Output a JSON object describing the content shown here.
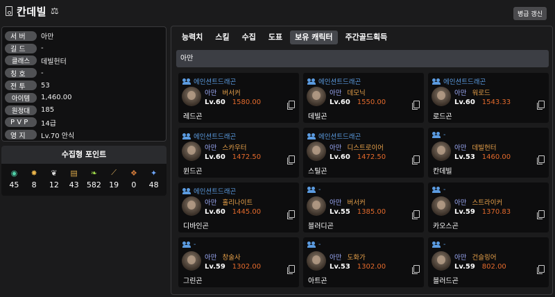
{
  "header": {
    "character_name": "칸데빌",
    "update_button": "병급 갱신"
  },
  "profile": [
    {
      "label": "서 버",
      "value": "아만"
    },
    {
      "label": "길 드",
      "value": "-"
    },
    {
      "label": "클래스",
      "value": "데빌헌터"
    },
    {
      "label": "칭 호",
      "value": "-"
    },
    {
      "label": "전 투",
      "value": "53"
    },
    {
      "label": "아이템",
      "value": "1,460.00"
    },
    {
      "label": "원정대",
      "value": "185"
    },
    {
      "label": "P V P",
      "value": "14급"
    },
    {
      "label": "영 지",
      "value": "Lv.70 안식"
    }
  ],
  "collect": {
    "title": "수집형 포인트",
    "items": [
      {
        "icon": "island-heart-icon",
        "value": "45"
      },
      {
        "icon": "giant-heart-icon",
        "value": "8"
      },
      {
        "icon": "mokoko-seed-icon",
        "value": "12"
      },
      {
        "icon": "masterpiece-icon",
        "value": "43"
      },
      {
        "icon": "sprout-icon",
        "value": "582"
      },
      {
        "icon": "adventure-icon",
        "value": "19"
      },
      {
        "icon": "orpheus-star-icon",
        "value": "0"
      },
      {
        "icon": "world-tree-leaf-icon",
        "value": "48"
      }
    ]
  },
  "tabs": [
    "능력치",
    "스킬",
    "수집",
    "도표",
    "보유 캐릭터",
    "주간골드획득"
  ],
  "active_tab": "보유 캐릭터",
  "server_section": "아만",
  "characters": [
    {
      "guild": "에인션트드래곤",
      "server": "아만",
      "class": "버서커",
      "level": "Lv.60",
      "item_level": "1580.00",
      "name": "레드곤"
    },
    {
      "guild": "에인션트드래곤",
      "server": "아만",
      "class": "데모닉",
      "level": "Lv.60",
      "item_level": "1550.00",
      "name": "데빌곤"
    },
    {
      "guild": "에인션트드래곤",
      "server": "아만",
      "class": "워로드",
      "level": "Lv.60",
      "item_level": "1543.33",
      "name": "로드곤"
    },
    {
      "guild": "에인션트드래곤",
      "server": "아만",
      "class": "스카우터",
      "level": "Lv.60",
      "item_level": "1472.50",
      "name": "윈드곤"
    },
    {
      "guild": "에인션트드래곤",
      "server": "아만",
      "class": "디스트로이어",
      "level": "Lv.60",
      "item_level": "1472.50",
      "name": "스틸곤"
    },
    {
      "guild": "-",
      "server": "아만",
      "class": "데빌헌터",
      "level": "Lv.53",
      "item_level": "1460.00",
      "name": "칸데빌"
    },
    {
      "guild": "에인션트드래곤",
      "server": "아만",
      "class": "홀리나이트",
      "level": "Lv.60",
      "item_level": "1445.00",
      "name": "디바인곤"
    },
    {
      "guild": "-",
      "server": "아만",
      "class": "버서커",
      "level": "Lv.55",
      "item_level": "1385.00",
      "name": "블러디곤"
    },
    {
      "guild": "-",
      "server": "아만",
      "class": "스트라이커",
      "level": "Lv.59",
      "item_level": "1370.83",
      "name": "카오스곤"
    },
    {
      "guild": "-",
      "server": "아만",
      "class": "창술사",
      "level": "Lv.59",
      "item_level": "1302.00",
      "name": "그린곤"
    },
    {
      "guild": "-",
      "server": "아만",
      "class": "도화가",
      "level": "Lv.53",
      "item_level": "1302.00",
      "name": "아트곤"
    },
    {
      "guild": "-",
      "server": "아만",
      "class": "건슬링어",
      "level": "Lv.59",
      "item_level": "802.00",
      "name": "블러드곤"
    }
  ]
}
